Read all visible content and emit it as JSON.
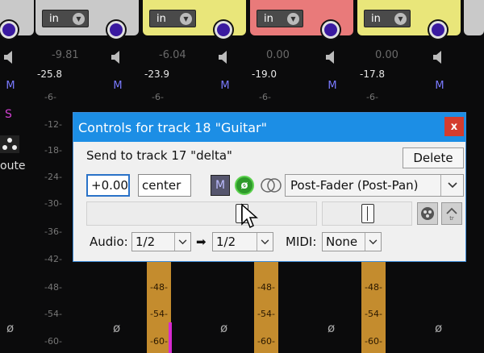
{
  "mixer": {
    "strips": [
      {
        "color": "#c9c9c9",
        "in_label": "in",
        "top_value": "-9.81",
        "peak": "-25.8",
        "mute": "M"
      },
      {
        "color": "#e9e67a",
        "in_label": "in",
        "top_value": "-6.04",
        "peak": "-23.9",
        "mute": "M"
      },
      {
        "color": "#e97a7a",
        "in_label": "in",
        "top_value": "0.00",
        "peak": "-19.0",
        "mute": "M"
      },
      {
        "color": "#e9e67a",
        "in_label": "in",
        "top_value": "0.00",
        "peak": "-17.8",
        "mute": "M"
      }
    ],
    "solo_label": "S",
    "route_label": "oute",
    "scale_ticks": [
      "-6-",
      "-12-",
      "-18-",
      "-24-",
      "-30-",
      "-36-",
      "-42-",
      "-48-",
      "-54-",
      "-60-"
    ],
    "meter_ticks": [
      "-48-",
      "-54-",
      "-60-"
    ],
    "phase_symbol": "ø"
  },
  "dialog": {
    "title": "Controls for track 18 \"Guitar\"",
    "close_label": "x",
    "send_label": "Send to track 17 \"delta\"",
    "delete_label": "Delete",
    "volume_value": "+0.00",
    "pan_value": "center",
    "mute_label": "M",
    "phase_label": "ø",
    "mode_selected": "Post-Fader (Post-Pan)",
    "audio_label": "Audio:",
    "audio_src": "1/2",
    "arrow": "➡",
    "audio_dst": "1/2",
    "midi_label": "MIDI:",
    "midi_value": "None"
  }
}
